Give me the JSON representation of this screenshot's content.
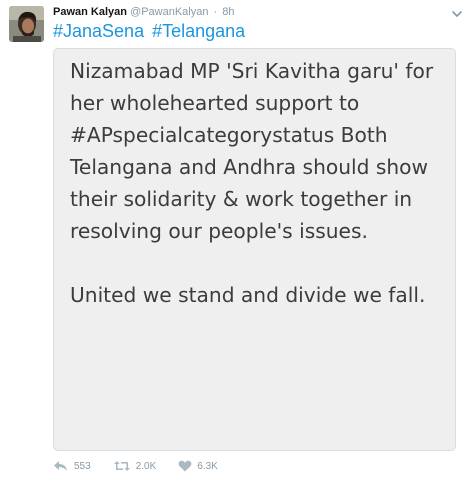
{
  "tweet": {
    "author_name": "Pawan Kalyan",
    "author_handle": "@PawanKalyan",
    "separator": "·",
    "time": "8h",
    "hashtags": [
      "#JanaSena",
      "#Telangana"
    ],
    "image_text": "Nizamabad MP 'Sri Kavitha garu' for her wholehearted support  to #APspecialcategorystatus Both Telangana and Andhra should show their solidarity & work together in resolving our people's issues.\n\nUnited we stand and divide we fall.",
    "actions": {
      "replies": "553",
      "retweets": "2.0K",
      "likes": "6.3K"
    },
    "icons": {
      "reply": "reply-icon",
      "retweet": "retweet-icon",
      "like": "heart-icon",
      "menu": "chevron-down-icon"
    },
    "colors": {
      "hashtag": "#1b95e0",
      "muted": "#8899a6",
      "name": "#14171a",
      "image_bg": "#efefef",
      "image_text": "#3c3c3c"
    }
  }
}
